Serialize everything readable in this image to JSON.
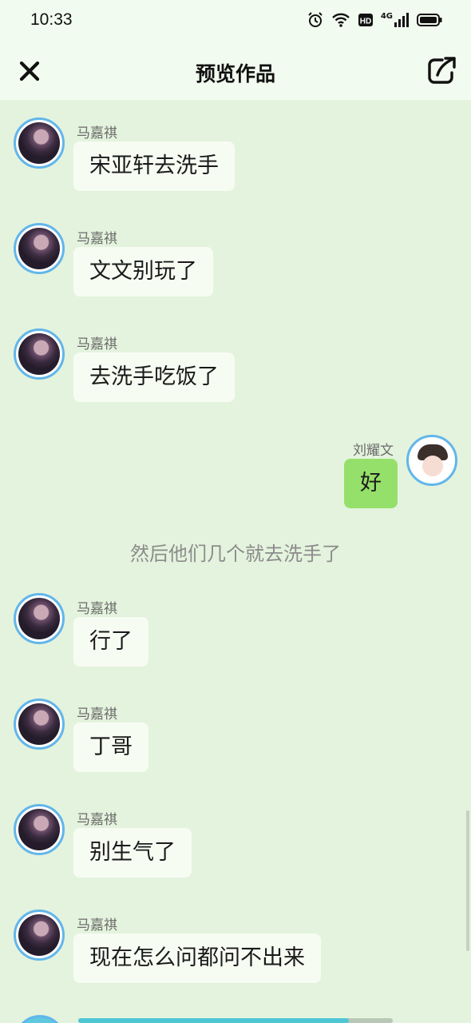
{
  "status": {
    "time": "10:33",
    "network": "4G",
    "icons": [
      "alarm-icon",
      "wifi-icon",
      "hd-icon",
      "signal-icon",
      "battery-icon"
    ]
  },
  "header": {
    "title": "预览作品",
    "close_icon": "close-icon",
    "share_icon": "share-icon"
  },
  "messages": [
    {
      "sender": "马嘉祺",
      "text": "宋亚轩去洗手",
      "side": "left"
    },
    {
      "sender": "马嘉祺",
      "text": "文文别玩了",
      "side": "left"
    },
    {
      "sender": "马嘉祺",
      "text": "去洗手吃饭了",
      "side": "left"
    },
    {
      "sender": "刘耀文",
      "text": "好",
      "side": "right"
    },
    {
      "sender": "马嘉祺",
      "text": "行了",
      "side": "left"
    },
    {
      "sender": "马嘉祺",
      "text": "丁哥",
      "side": "left"
    },
    {
      "sender": "马嘉祺",
      "text": "别生气了",
      "side": "left"
    },
    {
      "sender": "马嘉祺",
      "text": "现在怎么问都问不出来",
      "side": "left"
    }
  ],
  "narration": "然后他们几个就去洗手了",
  "progress": 0.86,
  "colors": {
    "bubble_left": "#f7fcf3",
    "bubble_right": "#95e06a",
    "background": "#e4f3dd",
    "avatar_ring": "#62b6ea"
  }
}
